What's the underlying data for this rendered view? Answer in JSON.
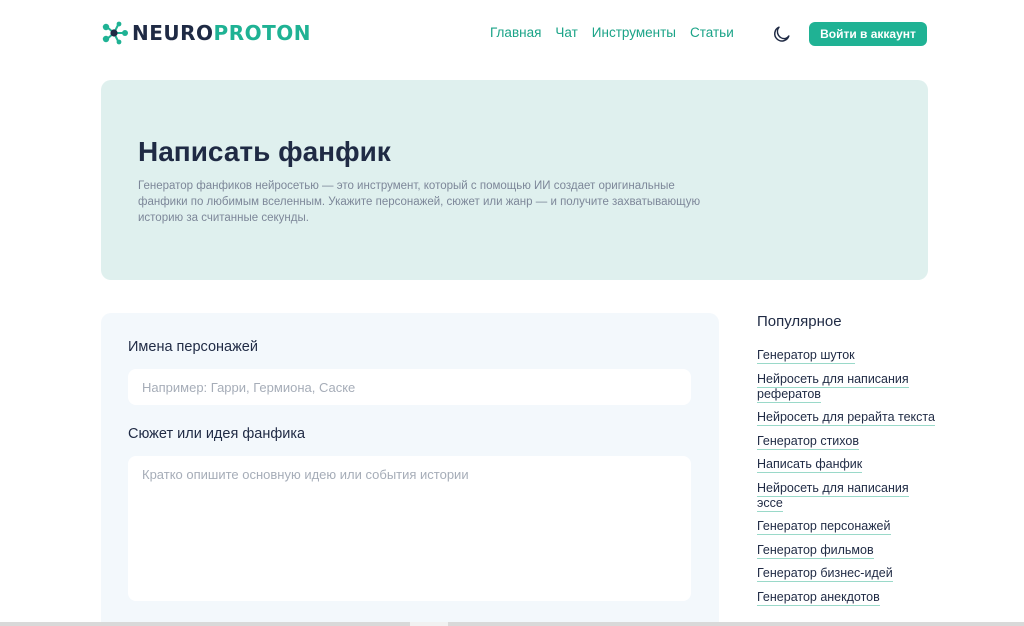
{
  "header": {
    "logo": {
      "part1": "NEURO",
      "part2": "PROTON"
    },
    "nav": [
      {
        "label": "Главная"
      },
      {
        "label": "Чат"
      },
      {
        "label": "Инструменты"
      },
      {
        "label": "Статьи"
      }
    ],
    "theme_icon": "moon-icon",
    "login_label": "Войти в аккаунт"
  },
  "hero": {
    "title": "Написать фанфик",
    "description": "Генератор фанфиков нейросетью — это инструмент, который с помощью ИИ создает оригинальные фанфики по любимым вселенным. Укажите персонажей, сюжет или жанр — и получите захватывающую историю за считанные секунды."
  },
  "form": {
    "characters_label": "Имена персонажей",
    "characters_placeholder": "Например: Гарри, Гермиона, Саске",
    "characters_value": "",
    "plot_label": "Сюжет или идея фанфика",
    "plot_placeholder": "Кратко опишите основную идею или события истории",
    "plot_value": ""
  },
  "sidebar": {
    "title": "Популярное",
    "items": [
      {
        "label": "Генератор шуток"
      },
      {
        "label": "Нейросеть для написания рефератов"
      },
      {
        "label": "Нейросеть для рерайта текста"
      },
      {
        "label": "Генератор стихов"
      },
      {
        "label": "Написать фанфик"
      },
      {
        "label": "Нейросеть для написания эссе"
      },
      {
        "label": "Генератор персонажей"
      },
      {
        "label": "Генератор фильмов"
      },
      {
        "label": "Генератор бизнес-идей"
      },
      {
        "label": "Генератор анекдотов"
      }
    ]
  },
  "colors": {
    "accent": "#1fb294",
    "hero_bg": "#dff0ee",
    "form_bg": "#f3f8fc",
    "text_dark": "#1f2a44"
  }
}
